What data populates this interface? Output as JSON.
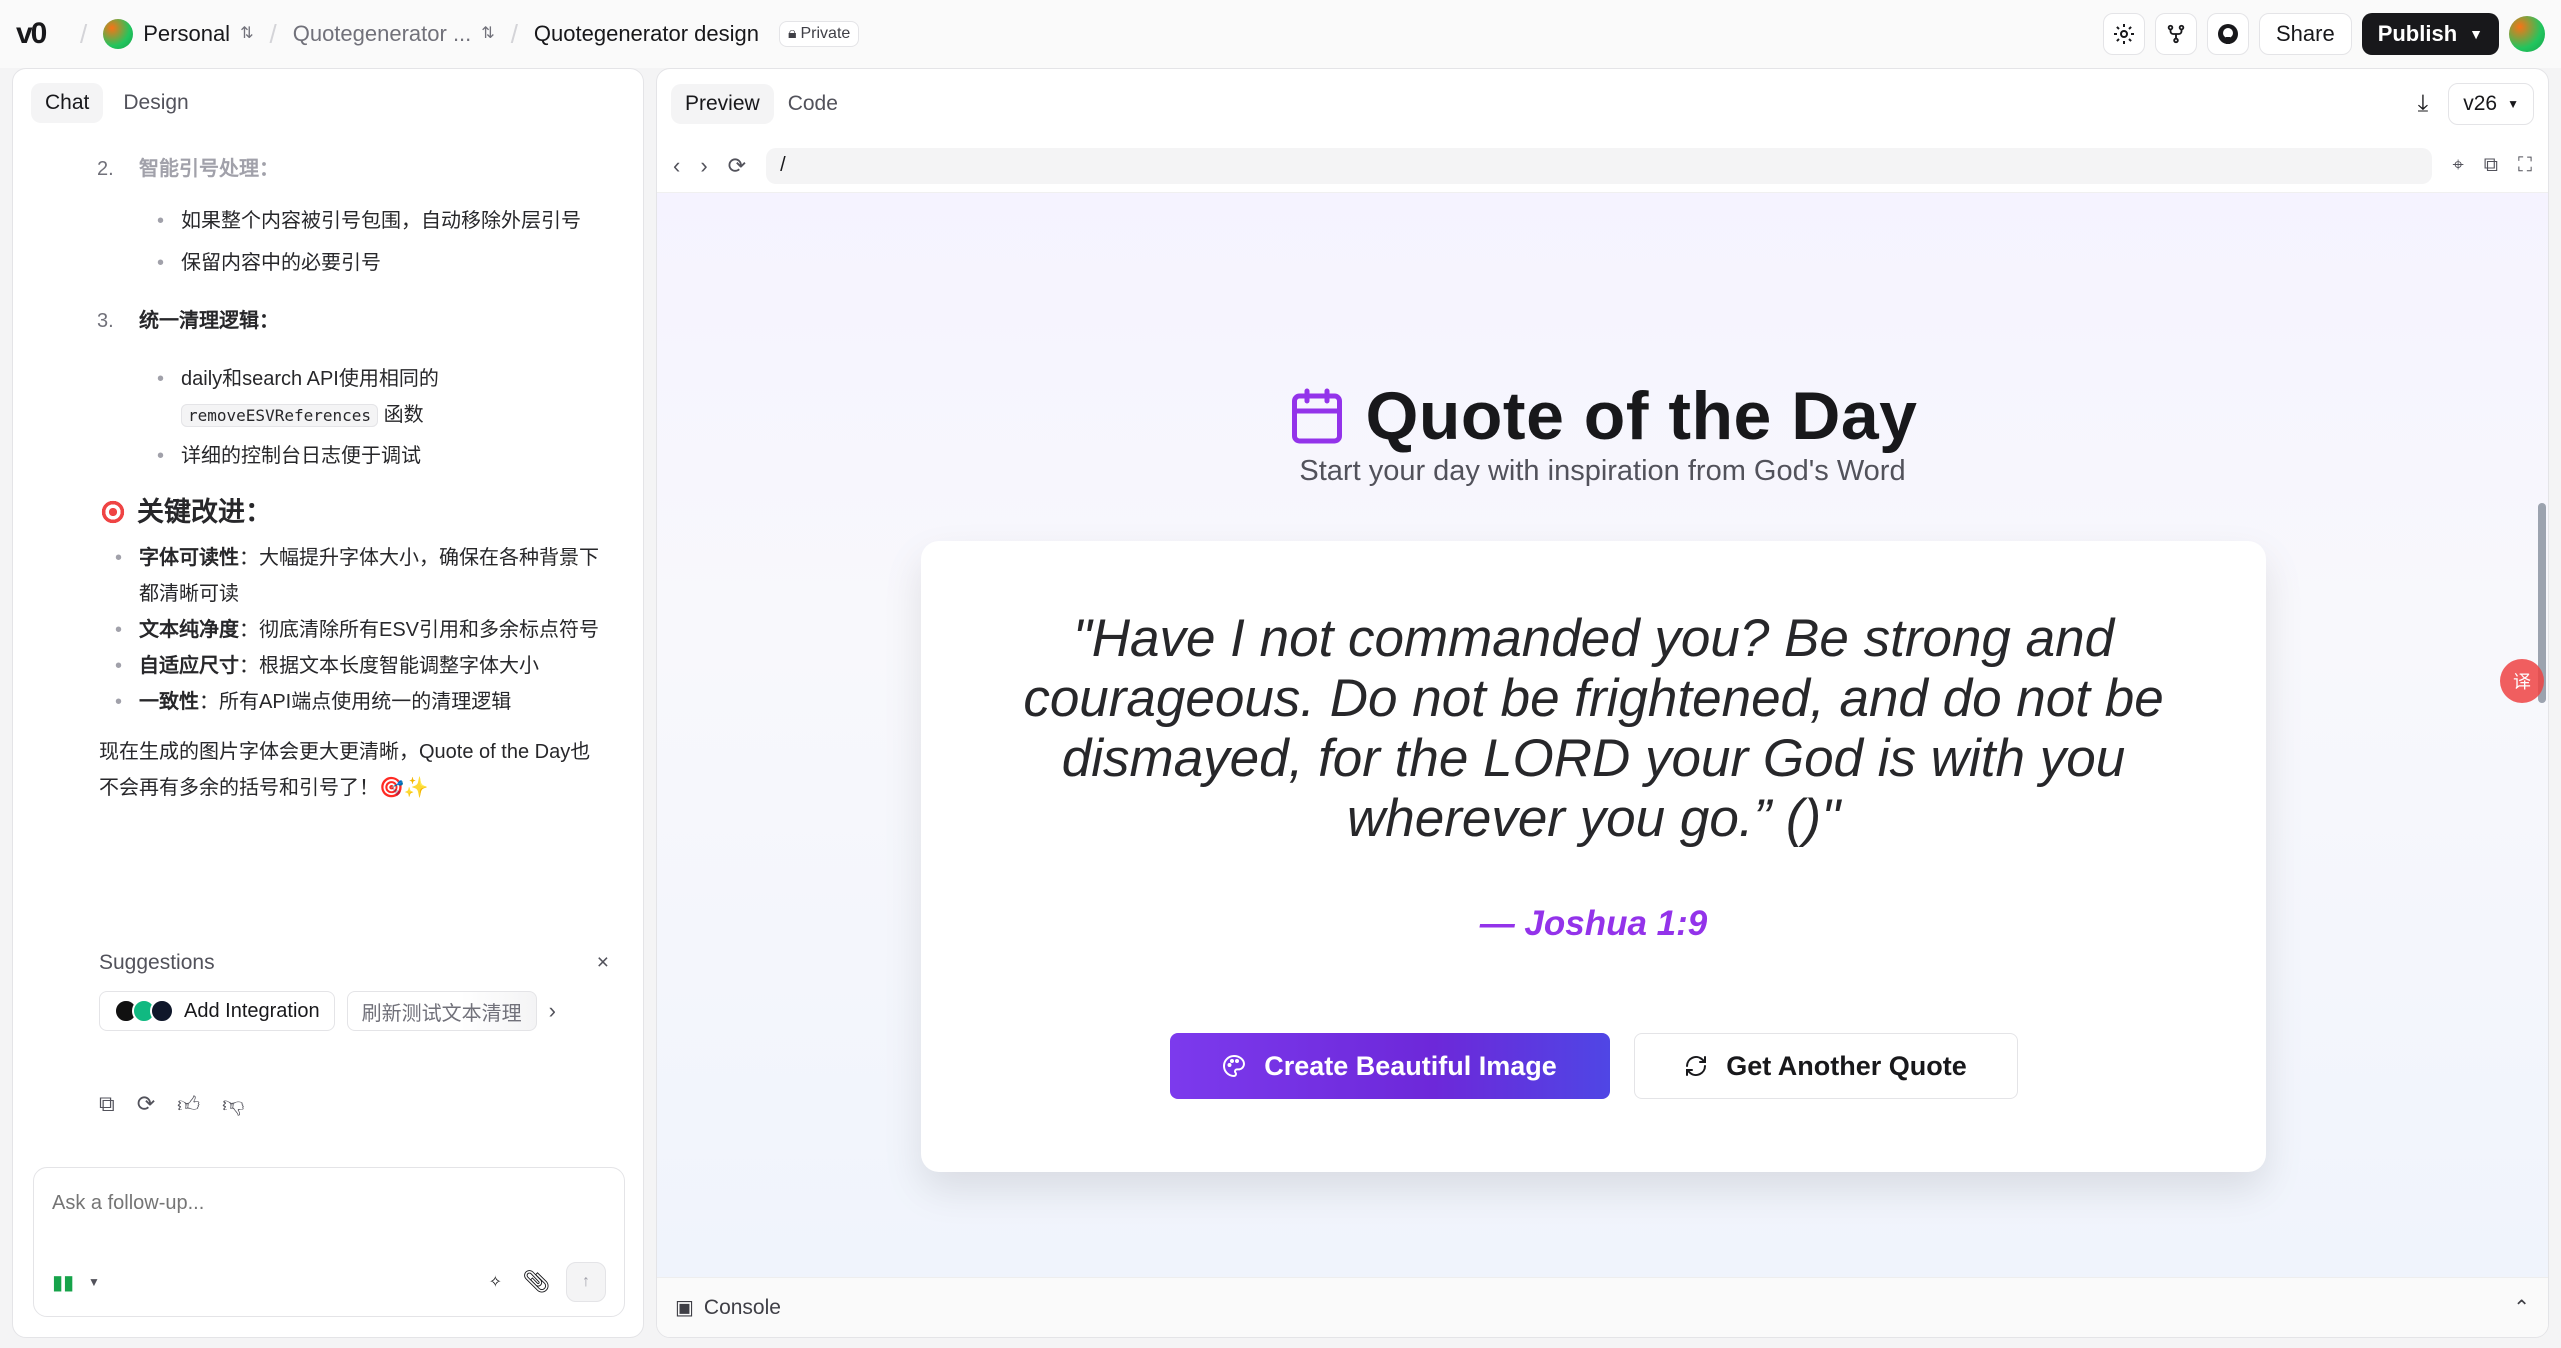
{
  "topbar": {
    "logo": "v0",
    "workspace": "Personal",
    "project": "Quotegenerator ...",
    "page": "Quotegenerator design",
    "private_label": "Private",
    "share_label": "Share",
    "publish_label": "Publish"
  },
  "chat": {
    "tabs": [
      "Chat",
      "Design"
    ],
    "item2": {
      "num": "2.",
      "title": "智能引号处理："
    },
    "item2_bullets": [
      "如果整个内容被引号包围，自动移除外层引号",
      "保留内容中的必要引号"
    ],
    "item3": {
      "num": "3.",
      "title": "统一清理逻辑："
    },
    "item3_bullet1_pre": "daily和search API使用相同的",
    "item3_bullet1_code": "removeESVReferences",
    "item3_bullet1_post": "函数",
    "item3_bullet2": "详细的控制台日志便于调试",
    "key_title": "关键改进：",
    "key_items": [
      {
        "label": "字体可读性",
        "text": "：大幅提升字体大小，确保在各种背景下都清晰可读"
      },
      {
        "label": "文本纯净度",
        "text": "：彻底清除所有ESV引用和多余标点符号"
      },
      {
        "label": "自适应尺寸",
        "text": "：根据文本长度智能调整字体大小"
      },
      {
        "label": "一致性",
        "text": "：所有API端点使用统一的清理逻辑"
      }
    ],
    "summary": "现在生成的图片字体会更大更清晰，Quote of the Day也不会再有多余的括号和引号了！🎯✨",
    "suggestions_title": "Suggestions",
    "close_glyph": "×",
    "chip_integration": "Add Integration",
    "chip_refresh": "刷新测试文本清理",
    "composer_placeholder": "Ask a follow-up..."
  },
  "preview": {
    "tabs": [
      "Preview",
      "Code"
    ],
    "version": "v26",
    "url": "/",
    "console_label": "Console"
  },
  "app": {
    "title": "Quote of the Day",
    "subtitle": "Start your day with inspiration from God's Word",
    "quote": "\"Have I not commanded you? Be strong and courageous. Do not be frightened, and do not be dismayed, for the LORD your God is with you wherever you go.” ()\"",
    "reference": "— Joshua 1:9",
    "primary_button": "Create Beautiful Image",
    "secondary_button": "Get Another Quote",
    "accent_color": "#7c3aed",
    "reference_color": "#9333ea"
  },
  "icons": {
    "calendar": "calendar-icon",
    "palette": "palette-icon",
    "refresh": "refresh-icon"
  }
}
